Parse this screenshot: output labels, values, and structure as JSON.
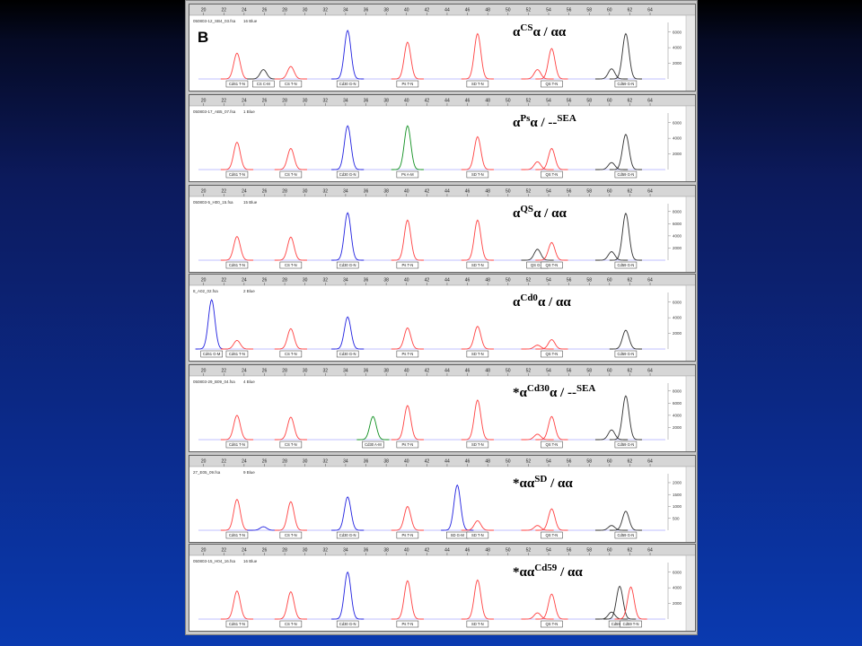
{
  "figure": {
    "panel_letter": "B",
    "x_ticks": [
      20,
      22,
      24,
      26,
      28,
      30,
      32,
      34,
      36,
      38,
      40,
      42,
      44,
      46,
      48,
      50,
      52,
      54,
      56,
      58,
      60,
      62,
      64
    ],
    "colors": {
      "red": "#ff4040",
      "blue": "#2020e0",
      "green": "#109020",
      "black": "#303030"
    }
  },
  "chart_data": [
    {
      "type": "line",
      "genotype": {
        "pre": "",
        "a": "α",
        "sup1": "CS",
        "mid": "α / αα",
        "sup2": ""
      },
      "file_label": "050803-12_SB4_03.fsa",
      "sample": "16 Blue",
      "y_ticks": [
        2000,
        4000,
        6000
      ],
      "ylim": [
        0,
        7000
      ],
      "peaks": [
        {
          "x": 23.3,
          "h": 3300,
          "color": "red",
          "label": "Cd61 T-N"
        },
        {
          "x": 25.9,
          "h": 1200,
          "color": "black",
          "label": "CS C-M"
        },
        {
          "x": 28.6,
          "h": 1600,
          "color": "red",
          "label": "CS T-N"
        },
        {
          "x": 34.2,
          "h": 6200,
          "color": "blue",
          "label": "Cd30 G-N"
        },
        {
          "x": 40.1,
          "h": 4700,
          "color": "red",
          "label": "Ps T-N"
        },
        {
          "x": 47.0,
          "h": 5800,
          "color": "red",
          "label": "SD T-N"
        },
        {
          "x": 52.9,
          "h": 1200,
          "color": "red",
          "label": ""
        },
        {
          "x": 54.3,
          "h": 3900,
          "color": "red",
          "label": "QS T-N"
        },
        {
          "x": 60.2,
          "h": 1300,
          "color": "black",
          "label": ""
        },
        {
          "x": 61.6,
          "h": 5800,
          "color": "black",
          "label": "Cd59 G-N"
        }
      ]
    },
    {
      "type": "line",
      "genotype": {
        "pre": "",
        "a": "α",
        "sup1": "Ps",
        "mid": "α / --",
        "sup2": "SEA"
      },
      "file_label": "050803-17_AB5_07.fsa",
      "sample": "1 Blue",
      "y_ticks": [
        2000,
        4000,
        6000
      ],
      "ylim": [
        0,
        7000
      ],
      "peaks": [
        {
          "x": 23.3,
          "h": 3500,
          "color": "red",
          "label": "Cd61 T-N"
        },
        {
          "x": 28.6,
          "h": 2700,
          "color": "red",
          "label": "CS T-N"
        },
        {
          "x": 34.2,
          "h": 5600,
          "color": "blue",
          "label": "Cd30 G-N"
        },
        {
          "x": 40.1,
          "h": 5600,
          "color": "green",
          "label": "Ps A-M"
        },
        {
          "x": 47.0,
          "h": 4200,
          "color": "red",
          "label": "SD T-N"
        },
        {
          "x": 52.9,
          "h": 1000,
          "color": "red",
          "label": ""
        },
        {
          "x": 54.3,
          "h": 2700,
          "color": "red",
          "label": "QS T-N"
        },
        {
          "x": 60.2,
          "h": 900,
          "color": "black",
          "label": ""
        },
        {
          "x": 61.6,
          "h": 4500,
          "color": "black",
          "label": "Cd59 G-N"
        }
      ]
    },
    {
      "type": "line",
      "genotype": {
        "pre": "",
        "a": "α",
        "sup1": "QS",
        "mid": "α / αα",
        "sup2": ""
      },
      "file_label": "050803-5_H00_15.fsa",
      "sample": "15 Blue",
      "y_ticks": [
        2000,
        4000,
        6000,
        8000
      ],
      "ylim": [
        0,
        9000
      ],
      "peaks": [
        {
          "x": 23.3,
          "h": 3900,
          "color": "red",
          "label": "Cd61 T-N"
        },
        {
          "x": 28.6,
          "h": 3800,
          "color": "red",
          "label": "CS T-N"
        },
        {
          "x": 34.2,
          "h": 7800,
          "color": "blue",
          "label": "Cd30 G-N"
        },
        {
          "x": 40.1,
          "h": 6600,
          "color": "red",
          "label": "Ps T-N"
        },
        {
          "x": 47.0,
          "h": 6600,
          "color": "red",
          "label": "SD T-N"
        },
        {
          "x": 52.9,
          "h": 1800,
          "color": "black",
          "label": "QS G-M"
        },
        {
          "x": 54.3,
          "h": 2900,
          "color": "red",
          "label": "QS T-N"
        },
        {
          "x": 60.2,
          "h": 1400,
          "color": "black",
          "label": ""
        },
        {
          "x": 61.6,
          "h": 7700,
          "color": "black",
          "label": "Cd59 G-N"
        }
      ]
    },
    {
      "type": "line",
      "genotype": {
        "pre": "",
        "a": "α",
        "sup1": "Cd0",
        "mid": "α / αα",
        "sup2": ""
      },
      "file_label": "8_A02_02.fsa",
      "sample": "2 Blue",
      "y_ticks": [
        2000,
        4000,
        6000
      ],
      "ylim": [
        0,
        7000
      ],
      "peaks": [
        {
          "x": 20.8,
          "h": 6300,
          "color": "blue",
          "label": "Cd61 G-M"
        },
        {
          "x": 23.3,
          "h": 1100,
          "color": "red",
          "label": "Cd61 T-N"
        },
        {
          "x": 28.6,
          "h": 2600,
          "color": "red",
          "label": "CS T-N"
        },
        {
          "x": 34.2,
          "h": 4100,
          "color": "blue",
          "label": "Cd30 G-N"
        },
        {
          "x": 40.1,
          "h": 2700,
          "color": "red",
          "label": "Ps T-N"
        },
        {
          "x": 47.0,
          "h": 2900,
          "color": "red",
          "label": "SD T-N"
        },
        {
          "x": 52.9,
          "h": 500,
          "color": "red",
          "label": ""
        },
        {
          "x": 54.3,
          "h": 1200,
          "color": "red",
          "label": "QS T-N"
        },
        {
          "x": 61.6,
          "h": 2400,
          "color": "black",
          "label": "Cd59 G-N"
        }
      ]
    },
    {
      "type": "line",
      "genotype": {
        "pre": "*",
        "a": "α",
        "sup1": "Cd30",
        "mid": "α / --",
        "sup2": "SEA"
      },
      "file_label": "050803-29_B09_04.fsa",
      "sample": "4 Blue",
      "y_ticks": [
        2000,
        4000,
        6000,
        8000
      ],
      "ylim": [
        0,
        9000
      ],
      "peaks": [
        {
          "x": 23.3,
          "h": 4000,
          "color": "red",
          "label": "Cd61 T-N"
        },
        {
          "x": 28.6,
          "h": 3700,
          "color": "red",
          "label": "CS T-N"
        },
        {
          "x": 36.7,
          "h": 3800,
          "color": "green",
          "label": "Cd30 A-M"
        },
        {
          "x": 40.1,
          "h": 5600,
          "color": "red",
          "label": "Ps T-N"
        },
        {
          "x": 47.0,
          "h": 6500,
          "color": "red",
          "label": "SD T-N"
        },
        {
          "x": 52.9,
          "h": 900,
          "color": "red",
          "label": ""
        },
        {
          "x": 54.3,
          "h": 3800,
          "color": "red",
          "label": "QS T-N"
        },
        {
          "x": 60.2,
          "h": 1600,
          "color": "black",
          "label": ""
        },
        {
          "x": 61.6,
          "h": 7200,
          "color": "black",
          "label": "Cd59 G-N"
        }
      ]
    },
    {
      "type": "line",
      "genotype": {
        "pre": "*",
        "a": "αα",
        "sup1": "SD",
        "mid": " / αα",
        "sup2": ""
      },
      "file_label": "27_E05_09.fsa",
      "sample": "9 Blue",
      "y_ticks": [
        500,
        1000,
        1500,
        2000
      ],
      "ylim": [
        0,
        2300
      ],
      "peaks": [
        {
          "x": 23.3,
          "h": 1300,
          "color": "red",
          "label": "Cd61 T-N"
        },
        {
          "x": 25.9,
          "h": 150,
          "color": "blue",
          "label": ""
        },
        {
          "x": 28.6,
          "h": 1200,
          "color": "red",
          "label": "CS T-N"
        },
        {
          "x": 34.2,
          "h": 1400,
          "color": "blue",
          "label": "Cd30 G-N"
        },
        {
          "x": 40.1,
          "h": 1000,
          "color": "red",
          "label": "Ps T-N"
        },
        {
          "x": 45.0,
          "h": 1900,
          "color": "blue",
          "label": "SD G-M"
        },
        {
          "x": 47.0,
          "h": 400,
          "color": "red",
          "label": "SD T-N"
        },
        {
          "x": 52.9,
          "h": 200,
          "color": "red",
          "label": ""
        },
        {
          "x": 54.3,
          "h": 900,
          "color": "red",
          "label": "QS T-N"
        },
        {
          "x": 60.2,
          "h": 200,
          "color": "black",
          "label": ""
        },
        {
          "x": 61.6,
          "h": 800,
          "color": "black",
          "label": "Cd59 G-N"
        }
      ]
    },
    {
      "type": "line",
      "genotype": {
        "pre": "*",
        "a": "αα",
        "sup1": "Cd59",
        "mid": " / αα",
        "sup2": ""
      },
      "file_label": "050803-15_H04_16.fsa",
      "sample": "16 Blue",
      "y_ticks": [
        2000,
        4000,
        6000
      ],
      "ylim": [
        0,
        7000
      ],
      "peaks": [
        {
          "x": 23.3,
          "h": 3600,
          "color": "red",
          "label": "Cd61 T-N"
        },
        {
          "x": 28.6,
          "h": 3500,
          "color": "red",
          "label": "CS T-N"
        },
        {
          "x": 34.2,
          "h": 6000,
          "color": "blue",
          "label": "Cd30 G-N"
        },
        {
          "x": 40.1,
          "h": 4900,
          "color": "red",
          "label": "Ps T-N"
        },
        {
          "x": 47.0,
          "h": 5000,
          "color": "red",
          "label": "SD T-N"
        },
        {
          "x": 52.9,
          "h": 800,
          "color": "red",
          "label": ""
        },
        {
          "x": 54.3,
          "h": 3200,
          "color": "red",
          "label": "QS T-N"
        },
        {
          "x": 60.2,
          "h": 900,
          "color": "black",
          "label": ""
        },
        {
          "x": 61.0,
          "h": 4200,
          "color": "black",
          "label": "Cd59 G-N"
        },
        {
          "x": 62.1,
          "h": 4100,
          "color": "red",
          "label": "Cd59 T-N"
        }
      ]
    }
  ]
}
